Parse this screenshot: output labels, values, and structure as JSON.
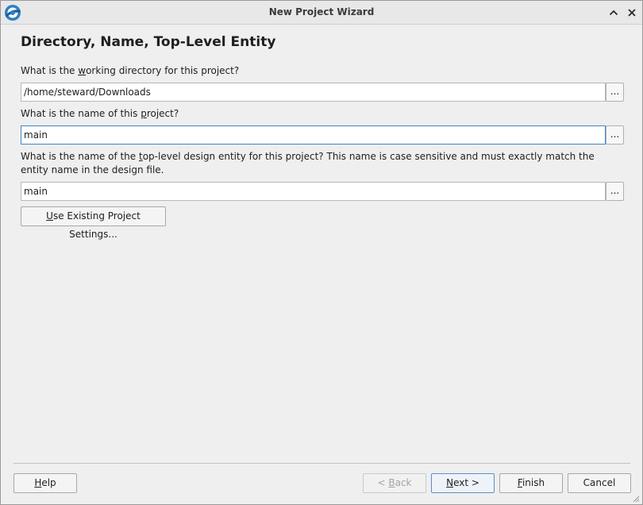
{
  "window": {
    "title": "New Project Wizard"
  },
  "page": {
    "heading": "Directory, Name, Top-Level Entity"
  },
  "working_directory": {
    "label_before": "What is the ",
    "label_mnemonic": "w",
    "label_after": "orking directory for this project?",
    "value": "/home/steward/Downloads",
    "browse_label": "..."
  },
  "project_name": {
    "label_before": "What is the name of this ",
    "label_mnemonic": "p",
    "label_after": "roject?",
    "value": "main",
    "browse_label": "..."
  },
  "top_level_entity": {
    "label_before": "What is the name of the ",
    "label_mnemonic": "t",
    "label_after": "op-level design entity for this project? This name is case sensitive and must exactly match the entity name in the design file.",
    "value": "main",
    "browse_label": "..."
  },
  "use_existing": {
    "mnemonic": "U",
    "label_rest": "se Existing Project Settings..."
  },
  "footer": {
    "help": {
      "mnemonic": "H",
      "rest": "elp"
    },
    "back": {
      "prefix": "< ",
      "mnemonic": "B",
      "rest": "ack"
    },
    "next": {
      "mnemonic": "N",
      "rest": "ext >"
    },
    "finish": {
      "mnemonic": "F",
      "rest": "inish"
    },
    "cancel": "Cancel"
  },
  "icons": {
    "app": "quartus-logo-icon",
    "collapse": "chevron-up-icon",
    "close": "close-icon",
    "resize": "resize-grip-icon"
  }
}
